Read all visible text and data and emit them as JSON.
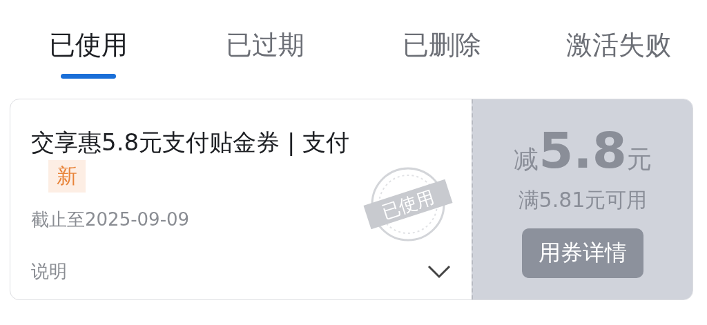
{
  "tabs": [
    {
      "label": "已使用",
      "selected": true
    },
    {
      "label": "已过期",
      "selected": false
    },
    {
      "label": "已删除",
      "selected": false
    },
    {
      "label": "激活失败",
      "selected": false
    }
  ],
  "coupon": {
    "title": "交享惠5.8元支付贴金券 | 支付",
    "badge": "新",
    "deadline": "截止至2025-09-09",
    "note_label": "说明",
    "stamp": "已使用",
    "prefix": "减",
    "amount": "5.8",
    "unit": "元",
    "condition": "满5.81元可用",
    "detail_button": "用券详情"
  }
}
